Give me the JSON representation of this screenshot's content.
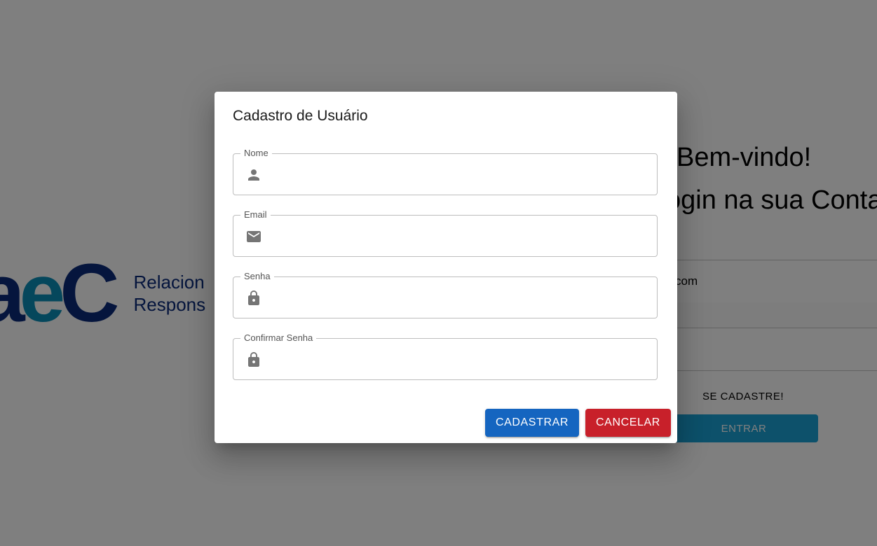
{
  "background": {
    "logo": {
      "mark_parts": [
        "a",
        "e",
        "C"
      ],
      "tagline_line1": "Relacion",
      "tagline_line2": "Respons"
    },
    "welcome": "Bem-vindo!",
    "login_subtitle": "ogin na sua Conta",
    "email_value": "com",
    "signup_link": "SE CADASTRE!",
    "enter_button": "ENTRAR"
  },
  "dialog": {
    "title": "Cadastro de Usuário",
    "fields": [
      {
        "label": "Nome",
        "icon": "person-icon",
        "value": ""
      },
      {
        "label": "Email",
        "icon": "email-icon",
        "value": ""
      },
      {
        "label": "Senha",
        "icon": "lock-icon",
        "value": ""
      },
      {
        "label": "Confirmar Senha",
        "icon": "lock-icon",
        "value": ""
      }
    ],
    "register_button": "CADASTRAR",
    "cancel_button": "CANCELAR"
  },
  "colors": {
    "register": "#1565c0",
    "cancel": "#c8202a",
    "brand_dark": "#0a2a7a",
    "brand_light": "#0a8fb8",
    "enter": "#1aa3d6"
  }
}
